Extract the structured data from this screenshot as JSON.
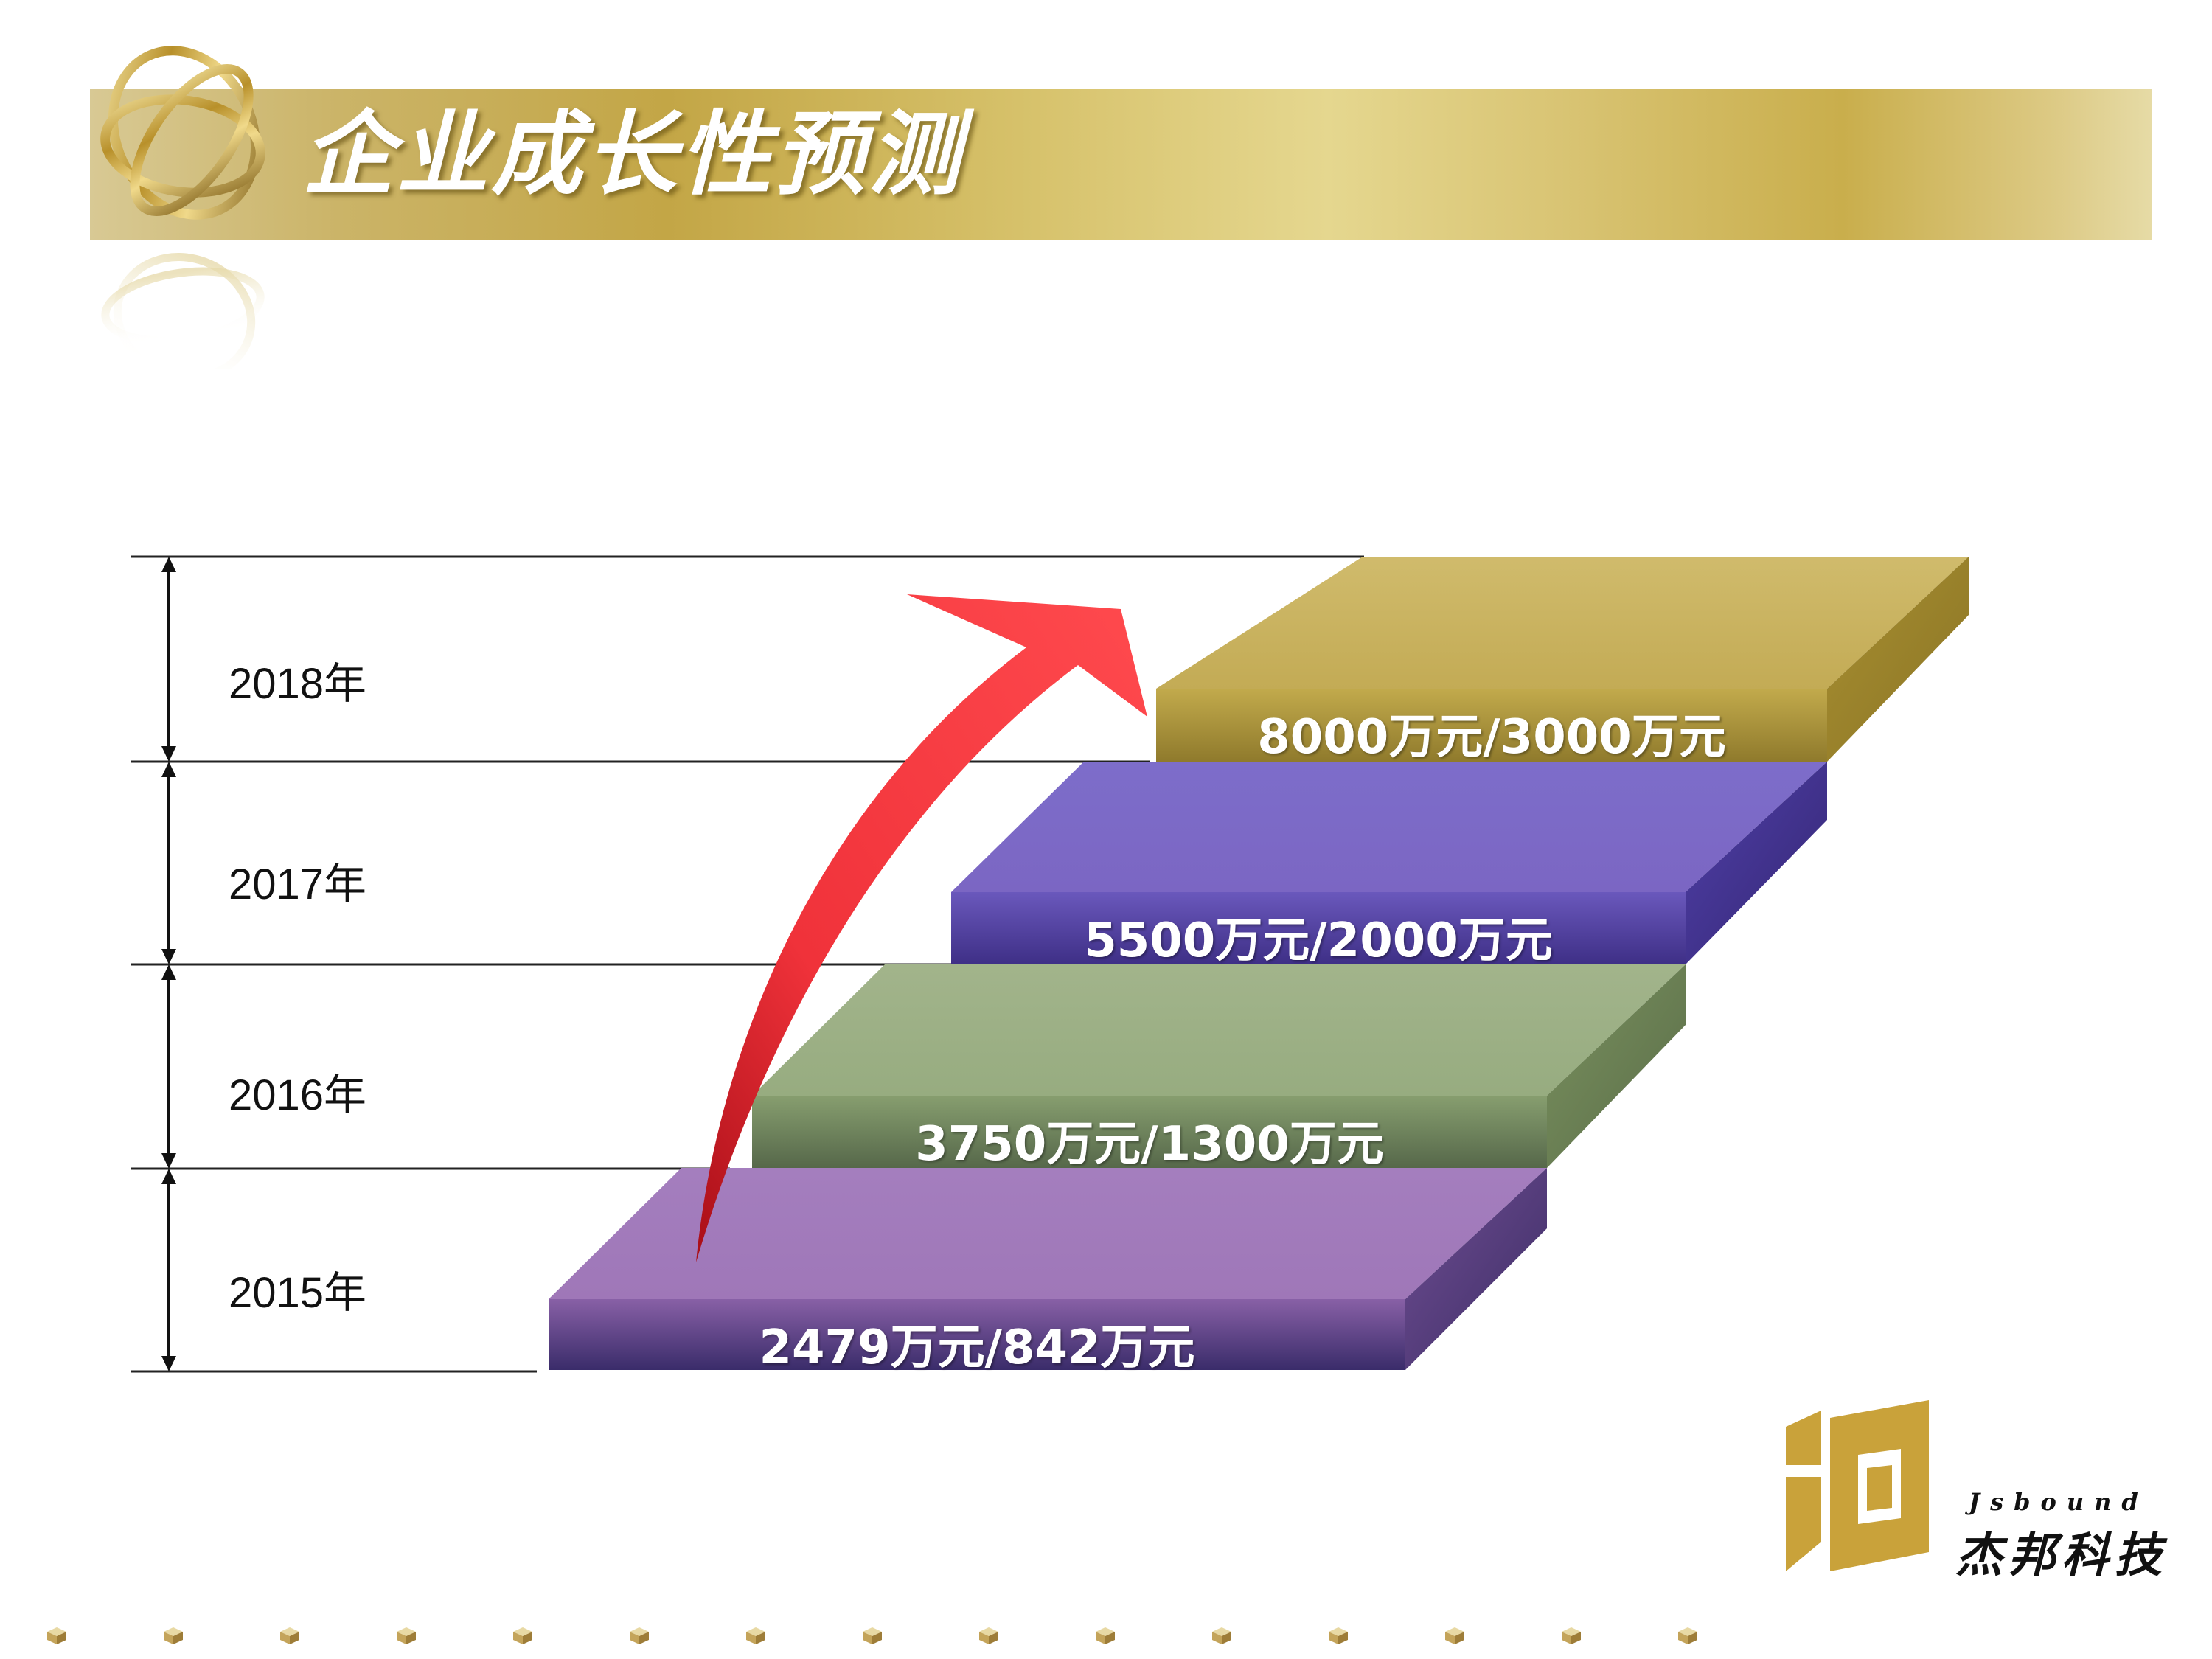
{
  "header": {
    "title": "企业成长性预测",
    "logo_icon": "gold-rings-icon"
  },
  "years": [
    {
      "label": "2018年"
    },
    {
      "label": "2017年"
    },
    {
      "label": "2016年"
    },
    {
      "label": "2015年"
    }
  ],
  "steps": [
    {
      "label": "8000万元/3000万元",
      "color": "#c4ad54"
    },
    {
      "label": "5500万元/2000万元",
      "color": "#7e6bc6"
    },
    {
      "label": "3750万元/1300万元",
      "color": "#9aae84"
    },
    {
      "label": "2479万元/842万元",
      "color": "#a078ba"
    }
  ],
  "arrow": {
    "color": "#f2323c",
    "icon": "growth-arrow-icon"
  },
  "footer": {
    "logo_en": "Jsbound",
    "logo_cn": "杰邦科技",
    "logo_color": "#c9a23a",
    "dot_icon": "small-cube-icon",
    "dot_count": 15
  }
}
